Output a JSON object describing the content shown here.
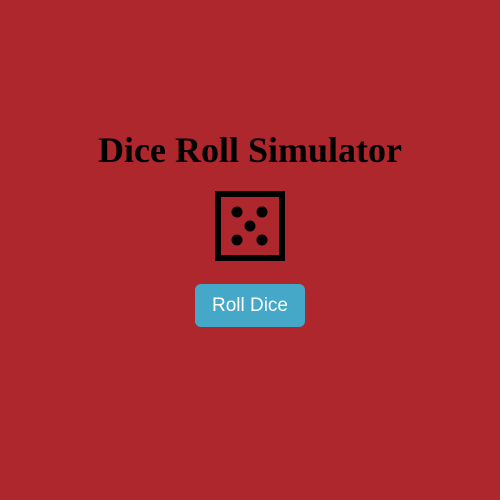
{
  "app": {
    "title": "Dice Roll Simulator"
  },
  "dice": {
    "icon": "die-face-5-icon",
    "face_value": 5
  },
  "controls": {
    "roll_label": "Roll Dice"
  },
  "colors": {
    "background": "#ad272c",
    "button_background": "#45a8c9",
    "button_text": "#ffffff",
    "title_text": "#000000",
    "dice": "#000000"
  }
}
